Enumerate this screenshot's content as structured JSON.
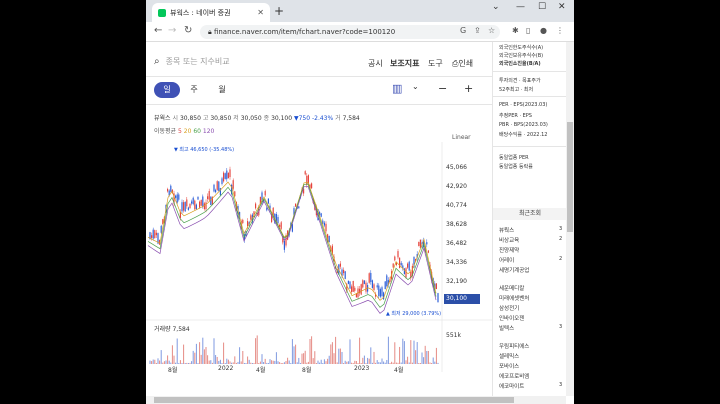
{
  "browser": {
    "tab_title": "뷰웍스 : 네이버 증권",
    "url": "finance.naver.com/item/fchart.naver?code=100120"
  },
  "icons": [
    "search-icon",
    "refresh-icon",
    "back-icon",
    "forward-icon",
    "star-icon",
    "share-icon",
    "puzzle-icon",
    "menu-icon",
    "print-icon",
    "candle-icon",
    "minus-icon",
    "plus-icon"
  ],
  "top": {
    "search_placeholder": "종목 또는 지수비교",
    "menu": [
      "공시",
      "보조지표",
      "도구",
      "인쇄"
    ]
  },
  "periods": [
    "일",
    "주",
    "월"
  ],
  "info": {
    "name": "뷰웍스",
    "open_lbl": "시",
    "open": "30,850",
    "high_lbl": "고",
    "high": "30,850",
    "low_lbl": "저",
    "low": "30,050",
    "close_lbl": "종",
    "close": "30,100",
    "change": "▼750 -2.43%",
    "volume_lbl": "거",
    "volume": "7,584",
    "ma_label": "이동평균",
    "ma": [
      "5",
      "20",
      "60",
      "120"
    ]
  },
  "chart": {
    "scale": "Linear",
    "y_ticks": [
      "45,066",
      "42,920",
      "40,774",
      "38,628",
      "36,482",
      "34,336",
      "32,190"
    ],
    "current": "30,100",
    "high_anno": "▼ 최고 46,650 (-35.48%)",
    "low_anno": "▲ 최저 29,000 (3.79%)",
    "volume_label": "거래량",
    "volume_value": "7,584",
    "volume_max": "551k",
    "x_ticks": [
      "8월",
      "2022",
      "4월",
      "8월",
      "2023",
      "4월"
    ]
  },
  "right_panel": {
    "lines": [
      "외국인한도주식수(A)",
      "외국인보유주식수(B)",
      "외국인소진율(B/A)",
      "투자의견 · 목표주가",
      "52주최고 · 최저",
      "PER · EPS(2023.03)",
      "추정PER · EPS",
      "PBR · BPS(2023.03)",
      "배당수익률 · 2022.12",
      "동일업종 PER",
      "동일업종 등락률"
    ],
    "recent_title": "최근조회",
    "recent": [
      "뷰웍스",
      "비상교육",
      "진양제약",
      "어레이",
      "세명기계공업",
      "세운메디칼",
      "미래에셋벤처",
      "삼성전기",
      "인바이오젠",
      "빌텍스",
      "우림피티에스",
      "셀레믹스",
      "포바이스",
      "에코프로비엠",
      "에코마이트"
    ],
    "recent_nums": [
      "3",
      "2",
      "2",
      "3",
      "3"
    ]
  }
}
